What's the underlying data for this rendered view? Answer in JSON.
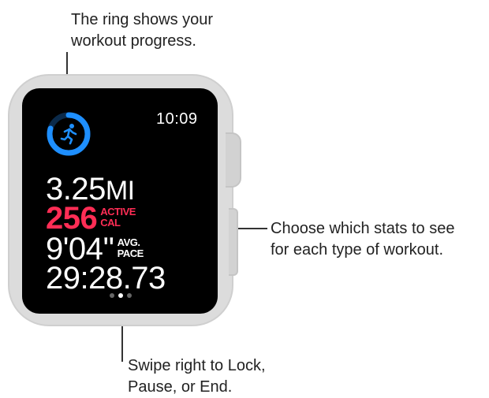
{
  "callouts": {
    "ring": [
      "The ring shows your",
      "workout progress."
    ],
    "stats": [
      "Choose which stats to see",
      "for each type of workout."
    ],
    "swipe": [
      "Swipe right to Lock,",
      "Pause, or End."
    ]
  },
  "watch": {
    "time": "10:09",
    "ring_icon": "running-figure-icon",
    "ring_color": "#1e8fff",
    "stats": {
      "distance": {
        "value": "3.25",
        "unit": "MI"
      },
      "active_cal": {
        "value": "256",
        "unit_line1": "ACTIVE",
        "unit_line2": "CAL",
        "color": "#ff2d55"
      },
      "pace": {
        "value": "9'04''",
        "unit_line1": "AVG.",
        "unit_line2": "PACE"
      },
      "duration": {
        "value": "29:28.73"
      }
    },
    "page_indicator": {
      "count": 3,
      "active_index": 1
    }
  }
}
